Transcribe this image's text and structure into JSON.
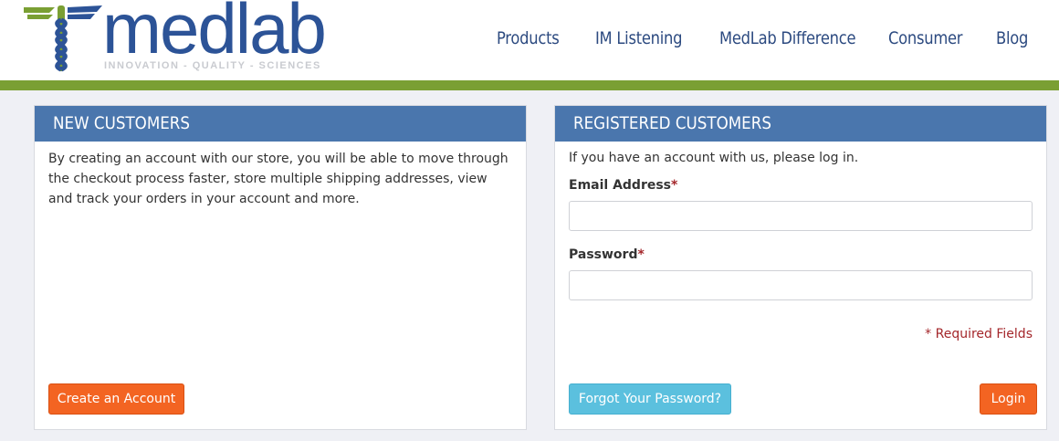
{
  "brand": {
    "name": "medlab",
    "tagline": "INNOVATION - QUALITY - SCIENCES",
    "colors": {
      "blue": "#2c5397",
      "green": "#7a9f33"
    }
  },
  "nav": {
    "items": [
      {
        "label": "Products"
      },
      {
        "label": "IM Listening"
      },
      {
        "label": "MedLab Difference"
      },
      {
        "label": "Consumer"
      },
      {
        "label": "Blog"
      }
    ]
  },
  "new_customers": {
    "title": "NEW CUSTOMERS",
    "description": "By creating an account with our store, you will be able to move through the checkout process faster, store multiple shipping addresses, view and track your orders in your account and more.",
    "create_button": "Create an Account"
  },
  "registered_customers": {
    "title": "REGISTERED CUSTOMERS",
    "intro": "If you have an account with us, please log in.",
    "email_label": "Email Address",
    "password_label": "Password",
    "required_star": "*",
    "email_value": "",
    "password_value": "",
    "required_note": "* Required Fields",
    "forgot_button": "Forgot Your Password?",
    "login_button": "Login"
  },
  "colors": {
    "panel_header": "#4a76ad",
    "primary_button": "#f36422",
    "secondary_button": "#5bc0de",
    "required": "#a4272b"
  }
}
